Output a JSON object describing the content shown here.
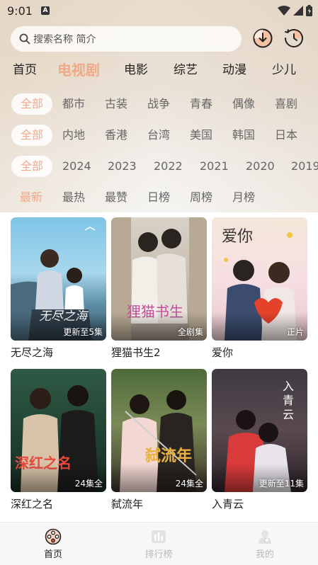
{
  "status_bar": {
    "time": "9:01",
    "notif_letter": "A"
  },
  "search": {
    "placeholder": "搜索名称 简介"
  },
  "main_tabs": [
    {
      "label": "首页",
      "active": false
    },
    {
      "label": "电视剧",
      "active": true
    },
    {
      "label": "电影",
      "active": false
    },
    {
      "label": "综艺",
      "active": false
    },
    {
      "label": "动漫",
      "active": false
    },
    {
      "label": "少儿",
      "active": false
    }
  ],
  "filters": {
    "genre": [
      "全部",
      "都市",
      "古装",
      "战争",
      "青春",
      "偶像",
      "喜剧"
    ],
    "region": [
      "全部",
      "内地",
      "香港",
      "台湾",
      "美国",
      "韩国",
      "日本"
    ],
    "year": [
      "全部",
      "2024",
      "2023",
      "2022",
      "2021",
      "2020",
      "2019"
    ],
    "sort": [
      "最新",
      "最热",
      "最赞",
      "日榜",
      "周榜",
      "月榜"
    ]
  },
  "shows": [
    {
      "title": "无尽之海",
      "badge": "更新至5集",
      "poster_text": "无尽之海"
    },
    {
      "title": "狸猫书生2",
      "badge": "全剧集",
      "poster_text": "狸猫书生"
    },
    {
      "title": "爱你",
      "badge": "正片",
      "poster_text": "爱你"
    },
    {
      "title": "深红之名",
      "badge": "24集全",
      "poster_text": "深红之名"
    },
    {
      "title": "弑流年",
      "badge": "24集全",
      "poster_text": "弑流年"
    },
    {
      "title": "入青云",
      "badge": "更新至11集",
      "poster_text": "入青云"
    }
  ],
  "bottom_nav": [
    {
      "label": "首页",
      "active": true
    },
    {
      "label": "排行榜",
      "active": false
    },
    {
      "label": "我的",
      "active": false
    }
  ],
  "colors": {
    "accent": "#f0a987",
    "text": "#222222",
    "muted": "#666666"
  }
}
